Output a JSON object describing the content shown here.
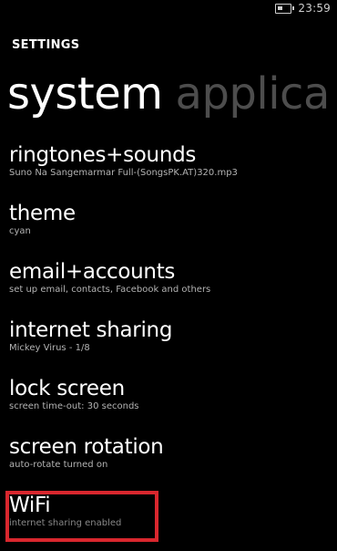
{
  "status_bar": {
    "battery_icon": "battery-icon",
    "time": "23:59"
  },
  "header": {
    "app_title": "SETTINGS",
    "pivot_active": "system",
    "pivot_next": "applica"
  },
  "settings": {
    "items": [
      {
        "title": "ringtones+sounds",
        "subtitle": "Suno Na Sangemarmar Full-(SongsPK.AT)320.mp3"
      },
      {
        "title": "theme",
        "subtitle": "cyan"
      },
      {
        "title": "email+accounts",
        "subtitle": "set up email, contacts, Facebook and others"
      },
      {
        "title": "internet sharing",
        "subtitle": "Mickey Virus - 1/8"
      },
      {
        "title": "lock screen",
        "subtitle": "screen time-out: 30 seconds"
      },
      {
        "title": "screen rotation",
        "subtitle": "auto-rotate turned on"
      },
      {
        "title": "WiFi",
        "subtitle": "internet sharing enabled"
      }
    ]
  },
  "colors": {
    "background": "#000000",
    "text": "#ffffff",
    "subtext": "#b3b3b3",
    "inactive_pivot": "#4d4d4d",
    "highlight": "#d9272e"
  }
}
